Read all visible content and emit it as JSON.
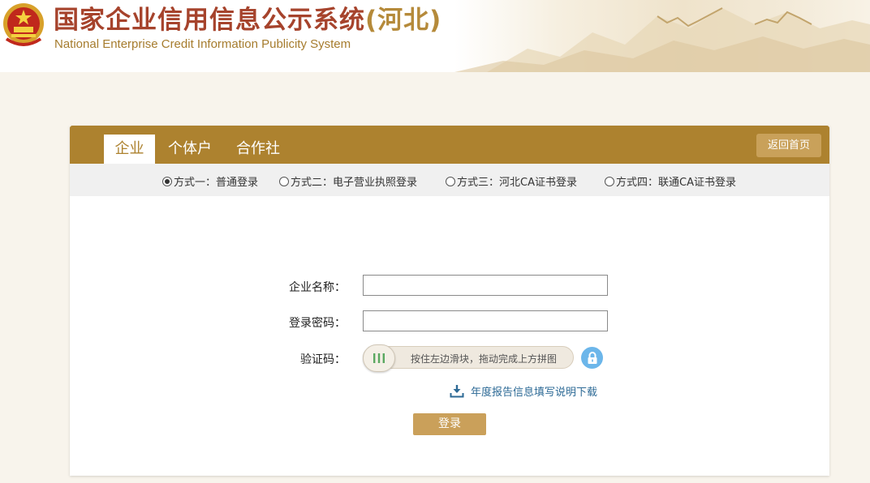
{
  "header": {
    "title_main": "国家企业信用信息公示系统",
    "title_province": "(河北)",
    "subtitle": "National Enterprise Credit Information Publicity System",
    "emblem_icon": "national-emblem-icon"
  },
  "tabs": [
    {
      "label": "企业",
      "active": true
    },
    {
      "label": "个体户",
      "active": false
    },
    {
      "label": "合作社",
      "active": false
    }
  ],
  "home_button": "返回首页",
  "login_methods": [
    {
      "label": "方式一：普通登录",
      "selected": true
    },
    {
      "label": "方式二：电子营业执照登录",
      "selected": false
    },
    {
      "label": "方式三：河北CA证书登录",
      "selected": false
    },
    {
      "label": "方式四：联通CA证书登录",
      "selected": false
    }
  ],
  "form": {
    "company_label": "企业名称：",
    "company_value": "",
    "password_label": "登录密码：",
    "password_value": "",
    "captcha_label": "验证码：",
    "slider_text": "按住左边滑块，拖动完成上方拼图",
    "download_text": "年度报告信息填写说明下载",
    "login_button": "登录"
  },
  "colors": {
    "accent": "#ad822f",
    "title_red": "#a6432c",
    "button_gold": "#caa05a",
    "link_blue": "#2d6a96",
    "lock_blue": "#6cb6ea"
  }
}
